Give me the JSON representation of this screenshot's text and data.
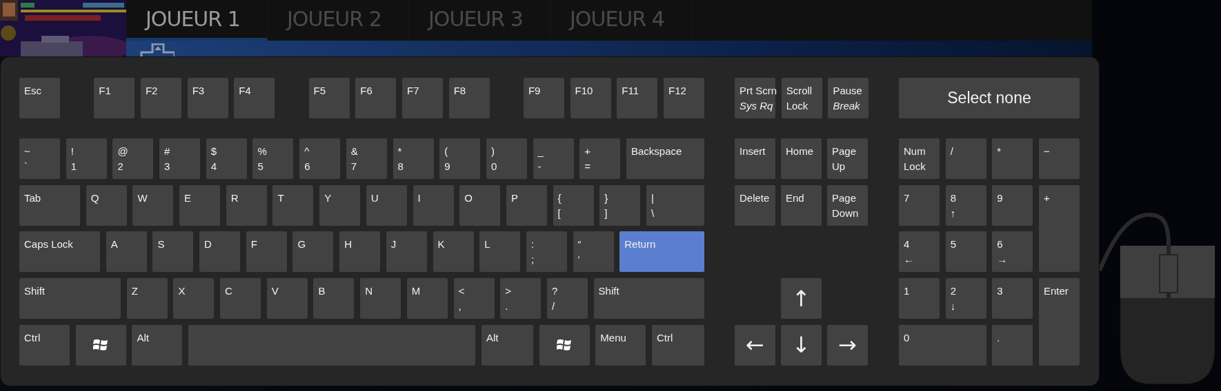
{
  "tabs": [
    {
      "label": "JOUEUR 1",
      "selected": true
    },
    {
      "label": "JOUEUR 2",
      "selected": false
    },
    {
      "label": "JOUEUR 3",
      "selected": false
    },
    {
      "label": "JOUEUR 4",
      "selected": false
    }
  ],
  "keyboard": {
    "function_groups": [
      {
        "keys": [
          {
            "lines": [
              "Esc"
            ],
            "selected": false
          }
        ]
      },
      {
        "keys": [
          {
            "lines": [
              "F1"
            ],
            "selected": false
          },
          {
            "lines": [
              "F2"
            ],
            "selected": false
          },
          {
            "lines": [
              "F3"
            ],
            "selected": false
          },
          {
            "lines": [
              "F4"
            ],
            "selected": false
          }
        ]
      },
      {
        "keys": [
          {
            "lines": [
              "F5"
            ],
            "selected": false
          },
          {
            "lines": [
              "F6"
            ],
            "selected": false
          },
          {
            "lines": [
              "F7"
            ],
            "selected": false
          },
          {
            "lines": [
              "F8"
            ],
            "selected": false
          }
        ]
      },
      {
        "keys": [
          {
            "lines": [
              "F9"
            ],
            "selected": false
          },
          {
            "lines": [
              "F10"
            ],
            "selected": false
          },
          {
            "lines": [
              "F11"
            ],
            "selected": false
          },
          {
            "lines": [
              "F12"
            ],
            "selected": false
          }
        ]
      }
    ],
    "main_rows": [
      {
        "keys": [
          {
            "lines": [
              "~",
              "`"
            ],
            "selected": false
          },
          {
            "lines": [
              "!",
              "1"
            ],
            "selected": false
          },
          {
            "lines": [
              "@",
              "2"
            ],
            "selected": false
          },
          {
            "lines": [
              "#",
              "3"
            ],
            "selected": false
          },
          {
            "lines": [
              "$",
              "4"
            ],
            "selected": false
          },
          {
            "lines": [
              "%",
              "5"
            ],
            "selected": false
          },
          {
            "lines": [
              "^",
              "6"
            ],
            "selected": false
          },
          {
            "lines": [
              "&",
              "7"
            ],
            "selected": false
          },
          {
            "lines": [
              "*",
              "8"
            ],
            "selected": false
          },
          {
            "lines": [
              "(",
              "9"
            ],
            "selected": false
          },
          {
            "lines": [
              ")",
              "0"
            ],
            "selected": false
          },
          {
            "lines": [
              "_",
              "-"
            ],
            "selected": false
          },
          {
            "lines": [
              "+",
              "="
            ],
            "selected": false
          },
          {
            "lines": [
              "Backspace"
            ],
            "selected": false
          }
        ]
      },
      {
        "keys": [
          {
            "lines": [
              "Tab"
            ],
            "selected": false
          },
          {
            "lines": [
              "Q"
            ],
            "selected": false
          },
          {
            "lines": [
              "W"
            ],
            "selected": false
          },
          {
            "lines": [
              "E"
            ],
            "selected": false
          },
          {
            "lines": [
              "R"
            ],
            "selected": false
          },
          {
            "lines": [
              "T"
            ],
            "selected": false
          },
          {
            "lines": [
              "Y"
            ],
            "selected": false
          },
          {
            "lines": [
              "U"
            ],
            "selected": false
          },
          {
            "lines": [
              "I"
            ],
            "selected": false
          },
          {
            "lines": [
              "O"
            ],
            "selected": false
          },
          {
            "lines": [
              "P"
            ],
            "selected": false
          },
          {
            "lines": [
              "{",
              "["
            ],
            "selected": false
          },
          {
            "lines": [
              "}",
              "]"
            ],
            "selected": false
          },
          {
            "lines": [
              "|",
              "\\"
            ],
            "selected": false
          }
        ]
      },
      {
        "keys": [
          {
            "lines": [
              "Caps Lock"
            ],
            "selected": false
          },
          {
            "lines": [
              "A"
            ],
            "selected": false
          },
          {
            "lines": [
              "S"
            ],
            "selected": false
          },
          {
            "lines": [
              "D"
            ],
            "selected": false
          },
          {
            "lines": [
              "F"
            ],
            "selected": false
          },
          {
            "lines": [
              "G"
            ],
            "selected": false
          },
          {
            "lines": [
              "H"
            ],
            "selected": false
          },
          {
            "lines": [
              "J"
            ],
            "selected": false
          },
          {
            "lines": [
              "K"
            ],
            "selected": false
          },
          {
            "lines": [
              "L"
            ],
            "selected": false
          },
          {
            "lines": [
              ":",
              ";"
            ],
            "selected": false
          },
          {
            "lines": [
              "“",
              "‘"
            ],
            "selected": false
          },
          {
            "lines": [
              "Return"
            ],
            "selected": true
          }
        ]
      },
      {
        "keys": [
          {
            "lines": [
              "Shift"
            ],
            "selected": false
          },
          {
            "lines": [
              "Z"
            ],
            "selected": false
          },
          {
            "lines": [
              "X"
            ],
            "selected": false
          },
          {
            "lines": [
              "C"
            ],
            "selected": false
          },
          {
            "lines": [
              "V"
            ],
            "selected": false
          },
          {
            "lines": [
              "B"
            ],
            "selected": false
          },
          {
            "lines": [
              "N"
            ],
            "selected": false
          },
          {
            "lines": [
              "M"
            ],
            "selected": false
          },
          {
            "lines": [
              "<",
              ","
            ],
            "selected": false
          },
          {
            "lines": [
              ">",
              "."
            ],
            "selected": false
          },
          {
            "lines": [
              "?",
              "/"
            ],
            "selected": false
          },
          {
            "lines": [
              "Shift"
            ],
            "selected": false
          }
        ]
      },
      {
        "keys": [
          {
            "kind": "legend",
            "lines": [
              "Ctrl"
            ],
            "selected": false
          },
          {
            "kind": "windows",
            "selected": false
          },
          {
            "kind": "legend",
            "lines": [
              "Alt"
            ],
            "selected": false
          },
          {
            "kind": "blank",
            "selected": false
          },
          {
            "kind": "legend",
            "lines": [
              "Alt"
            ],
            "selected": false
          },
          {
            "kind": "windows",
            "selected": false
          },
          {
            "kind": "legend",
            "lines": [
              "Menu"
            ],
            "selected": false
          },
          {
            "kind": "legend",
            "lines": [
              "Ctrl"
            ],
            "selected": false
          }
        ]
      }
    ],
    "system_keys": [
      {
        "lines": [
          "Prt Scrn"
        ],
        "alt": "Sys Rq",
        "selected": false
      },
      {
        "lines": [
          "Scroll",
          "Lock"
        ],
        "selected": false
      },
      {
        "lines": [
          "Pause"
        ],
        "alt": "Break",
        "selected": false
      }
    ],
    "nav_keys": [
      {
        "lines": [
          "Insert"
        ],
        "selected": false
      },
      {
        "lines": [
          "Home"
        ],
        "selected": false
      },
      {
        "lines": [
          "Page",
          "Up"
        ],
        "selected": false
      },
      {
        "lines": [
          "Delete"
        ],
        "selected": false
      },
      {
        "lines": [
          "End"
        ],
        "selected": false
      },
      {
        "lines": [
          "Page",
          "Down"
        ],
        "selected": false
      }
    ],
    "arrow_keys": [
      {
        "label": "↑",
        "selected": false
      },
      {
        "label": "←",
        "selected": false
      },
      {
        "label": "↓",
        "selected": false
      },
      {
        "label": "→",
        "selected": false
      }
    ],
    "select_none": {
      "label": "Select none"
    },
    "numpad_keys": [
      {
        "lines": [
          "Num",
          "Lock"
        ],
        "selected": false
      },
      {
        "lines": [
          "/"
        ],
        "selected": false
      },
      {
        "lines": [
          "*"
        ],
        "selected": false
      },
      {
        "lines": [
          "−"
        ],
        "selected": false
      },
      {
        "lines": [
          "7"
        ],
        "selected": false
      },
      {
        "lines": [
          "8",
          "↑"
        ],
        "selected": false
      },
      {
        "lines": [
          "9"
        ],
        "selected": false
      },
      {
        "lines": [
          "+"
        ],
        "selected": false
      },
      {
        "lines": [
          "4",
          "←"
        ],
        "selected": false
      },
      {
        "lines": [
          "5"
        ],
        "selected": false
      },
      {
        "lines": [
          "6",
          "→"
        ],
        "selected": false
      },
      {
        "lines": [
          "1"
        ],
        "selected": false
      },
      {
        "lines": [
          "2",
          "↓"
        ],
        "selected": false
      },
      {
        "lines": [
          "3"
        ],
        "selected": false
      },
      {
        "lines": [
          "Enter"
        ],
        "selected": false
      },
      {
        "lines": [
          "0"
        ],
        "selected": false
      },
      {
        "lines": [
          "."
        ],
        "selected": false
      }
    ]
  }
}
